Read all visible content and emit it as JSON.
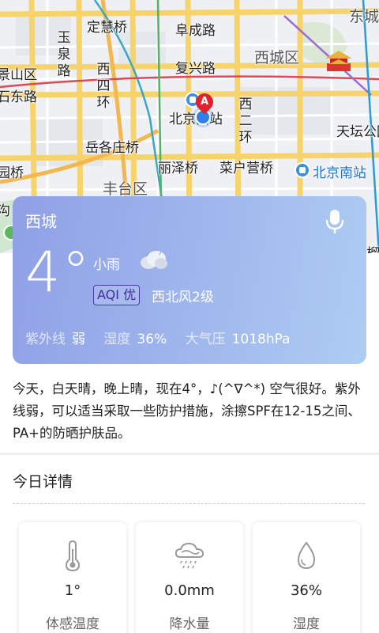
{
  "map": {
    "labels": {
      "dingzhaqiao": "定慧桥",
      "fuchenglu": "阜成路",
      "dongcheng": "东城",
      "yuquanlu": "玉泉路",
      "xisihuan": "西四环",
      "fuxinglu": "复兴路",
      "xicheng": "西城区",
      "jingshan": "景山区",
      "shidonglu": "石东路",
      "beijingzhan": "北京西站",
      "xierhuan": "西二环",
      "tiantan": "天坛公园",
      "yuegezhuang": "岳各庄桥",
      "lizeqiao": "丽泽桥",
      "caihuying": "菜户营桥",
      "beijingnan": "北京南站",
      "huanqiao": "园桥",
      "fengtai": "丰台区",
      "gou": "沟",
      "liu": "榴"
    },
    "pin_letter": "A"
  },
  "weather": {
    "city": "西城",
    "temperature": "4°",
    "condition": "小雨",
    "aqi": "AQI 优",
    "wind": "西北风2级",
    "uv_label": "紫外线",
    "uv_value": "弱",
    "humidity_label": "湿度",
    "humidity_value": "36%",
    "pressure_label": "大气压",
    "pressure_value": "1018hPa",
    "icons": {
      "mic": "microphone-icon",
      "condition": "light-rain-cloud-icon"
    }
  },
  "description": "今天，白天晴，晚上晴，现在4°，♪(^∇^*) 空气很好。紫外线弱，可以适当采取一些防护措施，涂擦SPF在12-15之间、PA+的防晒护肤品。",
  "details": {
    "title": "今日详情",
    "items": [
      {
        "value": "1°",
        "label": "体感温度",
        "icon": "thermometer-icon"
      },
      {
        "value": "0.0mm",
        "label": "降水量",
        "icon": "rain-icon"
      },
      {
        "value": "36%",
        "label": "湿度",
        "icon": "water-drop-icon"
      }
    ]
  },
  "colors": {
    "card_gradient_start": "#8fa0e6",
    "card_gradient_end": "#aecdf2",
    "aqi_border": "#4b3aa6",
    "road_major": "#f7d36b",
    "pin": "#e2222b",
    "location": "#2f7fe8"
  }
}
